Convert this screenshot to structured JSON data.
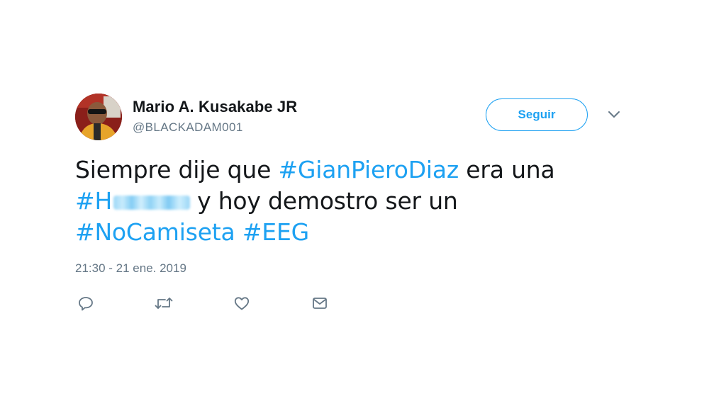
{
  "user": {
    "name": "Mario A. Kusakabe JR",
    "handle": "@BLACKADAM001"
  },
  "follow_button": {
    "label": "Seguir"
  },
  "tweet": {
    "line1_text": "Siempre dije que ",
    "hashtag1": "#GianPieroDiaz",
    "line1_end": " era una",
    "hashtag2_visible": "#H",
    "line2_text": "y hoy demostro ser un",
    "hashtag3": "#NoCamiseta",
    "hashtag4": "#EEG"
  },
  "timestamp": "21:30 - 21 ene. 2019",
  "actions": [
    {
      "icon": "reply-icon"
    },
    {
      "icon": "retweet-icon"
    },
    {
      "icon": "like-icon"
    },
    {
      "icon": "direct-message-icon"
    }
  ],
  "colors": {
    "accent": "#1da1f2",
    "text": "#14171a",
    "secondary": "#657786"
  }
}
